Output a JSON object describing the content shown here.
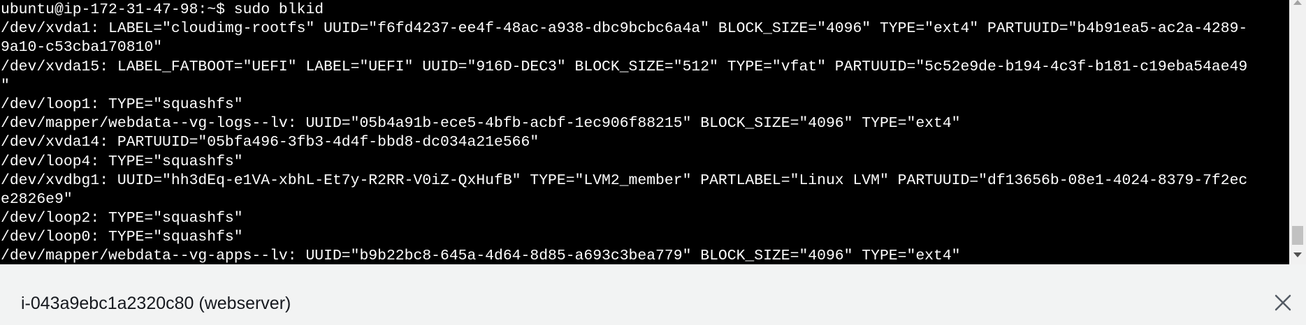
{
  "terminal": {
    "lines": [
      "ubuntu@ip-172-31-47-98:~$ sudo blkid",
      "/dev/xvda1: LABEL=\"cloudimg-rootfs\" UUID=\"f6fd4237-ee4f-48ac-a938-dbc9bcbc6a4a\" BLOCK_SIZE=\"4096\" TYPE=\"ext4\" PARTUUID=\"b4b91ea5-ac2a-4289-",
      "9a10-c53cba170810\"",
      "/dev/xvda15: LABEL_FATBOOT=\"UEFI\" LABEL=\"UEFI\" UUID=\"916D-DEC3\" BLOCK_SIZE=\"512\" TYPE=\"vfat\" PARTUUID=\"5c52e9de-b194-4c3f-b181-c19eba54ae49",
      "\"",
      "/dev/loop1: TYPE=\"squashfs\"",
      "/dev/mapper/webdata--vg-logs--lv: UUID=\"05b4a91b-ece5-4bfb-acbf-1ec906f88215\" BLOCK_SIZE=\"4096\" TYPE=\"ext4\"",
      "/dev/xvda14: PARTUUID=\"05bfa496-3fb3-4d4f-bbd8-dc034a21e566\"",
      "/dev/loop4: TYPE=\"squashfs\"",
      "/dev/xvdbg1: UUID=\"hh3dEq-e1VA-xbhL-Et7y-R2RR-V0iZ-QxHufB\" TYPE=\"LVM2_member\" PARTLABEL=\"Linux LVM\" PARTUUID=\"df13656b-08e1-4024-8379-7f2ec",
      "e2826e9\"",
      "/dev/loop2: TYPE=\"squashfs\"",
      "/dev/loop0: TYPE=\"squashfs\"",
      "/dev/mapper/webdata--vg-apps--lv: UUID=\"b9b22bc8-645a-4d64-8d85-a693c3bea779\" BLOCK_SIZE=\"4096\" TYPE=\"ext4\""
    ],
    "background_color": "#000000",
    "text_color": "#ffffff"
  },
  "footer": {
    "instance_label": "i-043a9ebc1a2320c80 (webserver)",
    "close_icon": "close-icon"
  }
}
